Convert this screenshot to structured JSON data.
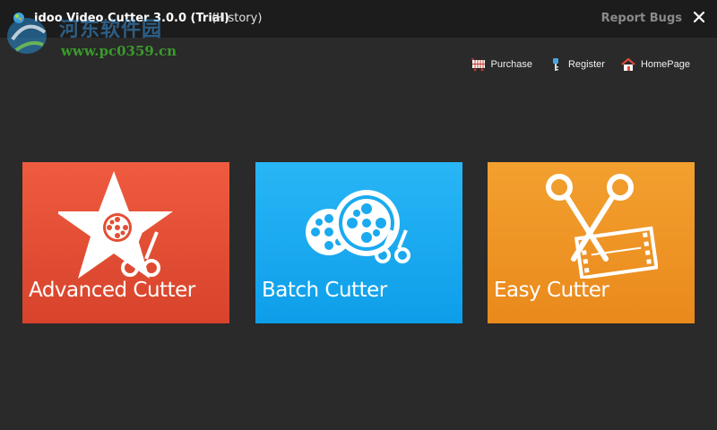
{
  "window": {
    "title": "idoo Video Cutter 3.0.0 (Trial)",
    "subtitle": "(History)",
    "report_bugs": "Report Bugs"
  },
  "watermark": {
    "site_name": "河东软件园",
    "url": "www.pc0359.cn"
  },
  "toplinks": [
    {
      "label": "Purchase",
      "icon": "cart-icon"
    },
    {
      "label": "Register",
      "icon": "key-icon"
    },
    {
      "label": "HomePage",
      "icon": "home-icon"
    }
  ],
  "tiles": [
    {
      "label": "Advanced Cutter",
      "icon": "star-film-scissors-icon",
      "color": "#e24f35"
    },
    {
      "label": "Batch Cutter",
      "icon": "film-reels-scissors-icon",
      "color": "#1aaaf0"
    },
    {
      "label": "Easy Cutter",
      "icon": "scissors-film-icon",
      "color": "#ee9526"
    }
  ]
}
